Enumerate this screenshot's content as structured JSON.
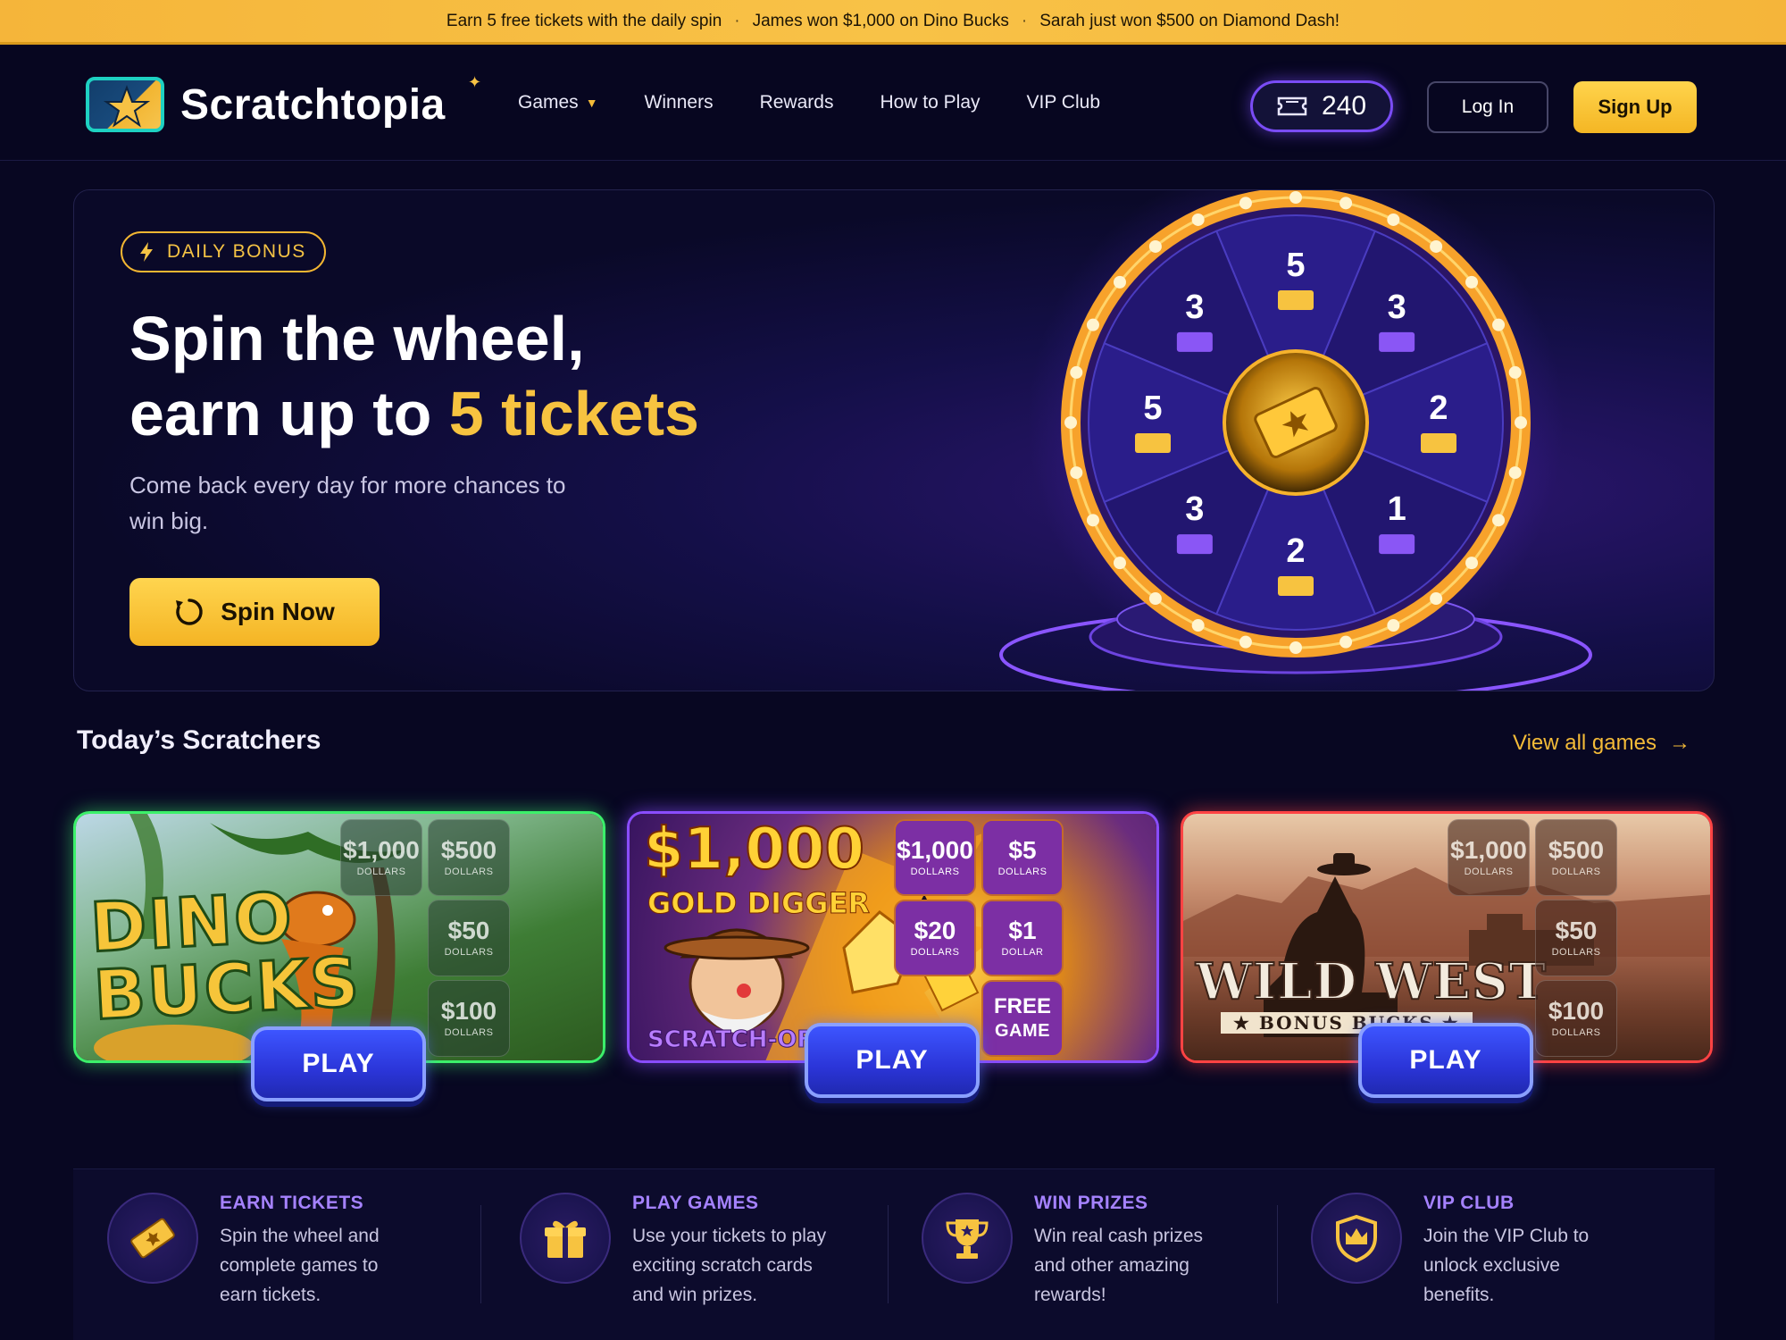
{
  "ticker": {
    "item1": "Earn 5 free tickets with the daily spin",
    "item2": "James won $1,000 on Dino Bucks",
    "item3": "Sarah just won $500 on Diamond Dash!",
    "separator": "·"
  },
  "nav": {
    "brand": "Scratchtopia",
    "links": [
      "Games",
      "Winners",
      "Rewards",
      "How to Play",
      "VIP Club"
    ],
    "ticket_count": "240",
    "login_label": "Log In",
    "signup_label": "Sign Up",
    "accent": "#f4bb38"
  },
  "hero": {
    "badge": "DAILY BONUS",
    "title_line1": "Spin the wheel,",
    "title_line2_prefix": "earn up to ",
    "title_line2_highlight": "5 tickets",
    "subtitle": "Come back every day for more chances to win big.",
    "cta_label": "Spin Now",
    "wheel_values": [
      "5",
      "3",
      "2",
      "1",
      "2",
      "3",
      "5",
      "3"
    ]
  },
  "scratchers": {
    "title": "Today’s Scratchers",
    "view_all_label": "View all games",
    "play_label": "PLAY",
    "cards": [
      {
        "title": "DINO",
        "title2": "BUCKS",
        "tiles": [
          {
            "value": "$1,000",
            "unit": "DOLLARS"
          },
          {
            "value": "$500",
            "unit": "DOLLARS"
          },
          {
            "value": "$50",
            "unit": "DOLLARS"
          },
          {
            "value": "$100",
            "unit": "DOLLARS"
          }
        ]
      },
      {
        "title": "$1,000",
        "title2": "GOLD DIGGER",
        "title3": "SCRATCH-OFF!",
        "tiles": [
          {
            "value": "$1,000",
            "unit": "DOLLARS"
          },
          {
            "value": "$5",
            "unit": "DOLLARS"
          },
          {
            "value": "$20",
            "unit": "DOLLARS"
          },
          {
            "value": "$1",
            "unit": "DOLLAR"
          },
          {
            "value": "FREE",
            "unit": "GAME"
          }
        ]
      },
      {
        "title": "WILD WEST",
        "title2": "★ BONUS BUCKS ★",
        "tiles": [
          {
            "value": "$1,000",
            "unit": "DOLLARS"
          },
          {
            "value": "$500",
            "unit": "DOLLARS"
          },
          {
            "value": "$50",
            "unit": "DOLLARS"
          },
          {
            "value": "$100",
            "unit": "DOLLARS"
          }
        ]
      }
    ]
  },
  "features": [
    {
      "icon": "ticket-icon",
      "title": "EARN TICKETS",
      "desc": "Spin the wheel and complete games to earn tickets."
    },
    {
      "icon": "gift-icon",
      "title": "PLAY GAMES",
      "desc": "Use your tickets to play exciting scratch cards and win prizes."
    },
    {
      "icon": "trophy-icon",
      "title": "WIN PRIZES",
      "desc": "Win real cash prizes and other amazing rewards!"
    },
    {
      "icon": "shield-crown-icon",
      "title": "VIP CLUB",
      "desc": "Join the VIP Club to unlock exclusive benefits."
    }
  ]
}
